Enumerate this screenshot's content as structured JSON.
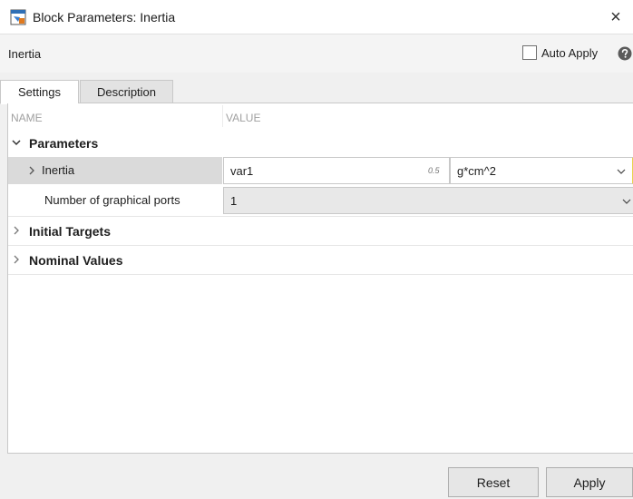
{
  "window": {
    "title": "Block Parameters: Inertia",
    "close_icon": "close-icon",
    "app_icon": "block-parameters-icon"
  },
  "block": {
    "name": "Inertia",
    "auto_apply": {
      "label": "Auto Apply",
      "checked": false
    },
    "help_icon": "help-icon"
  },
  "tabs": [
    {
      "label": "Settings",
      "active": true
    },
    {
      "label": "Description",
      "active": false
    }
  ],
  "table": {
    "headers": {
      "name": "NAME",
      "value": "VALUE"
    },
    "sections": [
      {
        "title": "Parameters",
        "expanded": true,
        "rows": [
          {
            "name": "Inertia",
            "value": "var1",
            "badge": "0.5",
            "unit": "g*cm^2",
            "expandable": true
          },
          {
            "name": "Number of graphical ports",
            "value": "1"
          }
        ]
      },
      {
        "title": "Initial Targets",
        "expanded": false
      },
      {
        "title": "Nominal Values",
        "expanded": false
      }
    ]
  },
  "buttons": {
    "reset": "Reset",
    "apply": "Apply"
  },
  "colors": {
    "accent": "#0072bd",
    "selected_row": "#dadada",
    "panel_bg": "#ffffff",
    "window_bg": "#f0f0f0",
    "focus_border": "#e8d44d"
  }
}
